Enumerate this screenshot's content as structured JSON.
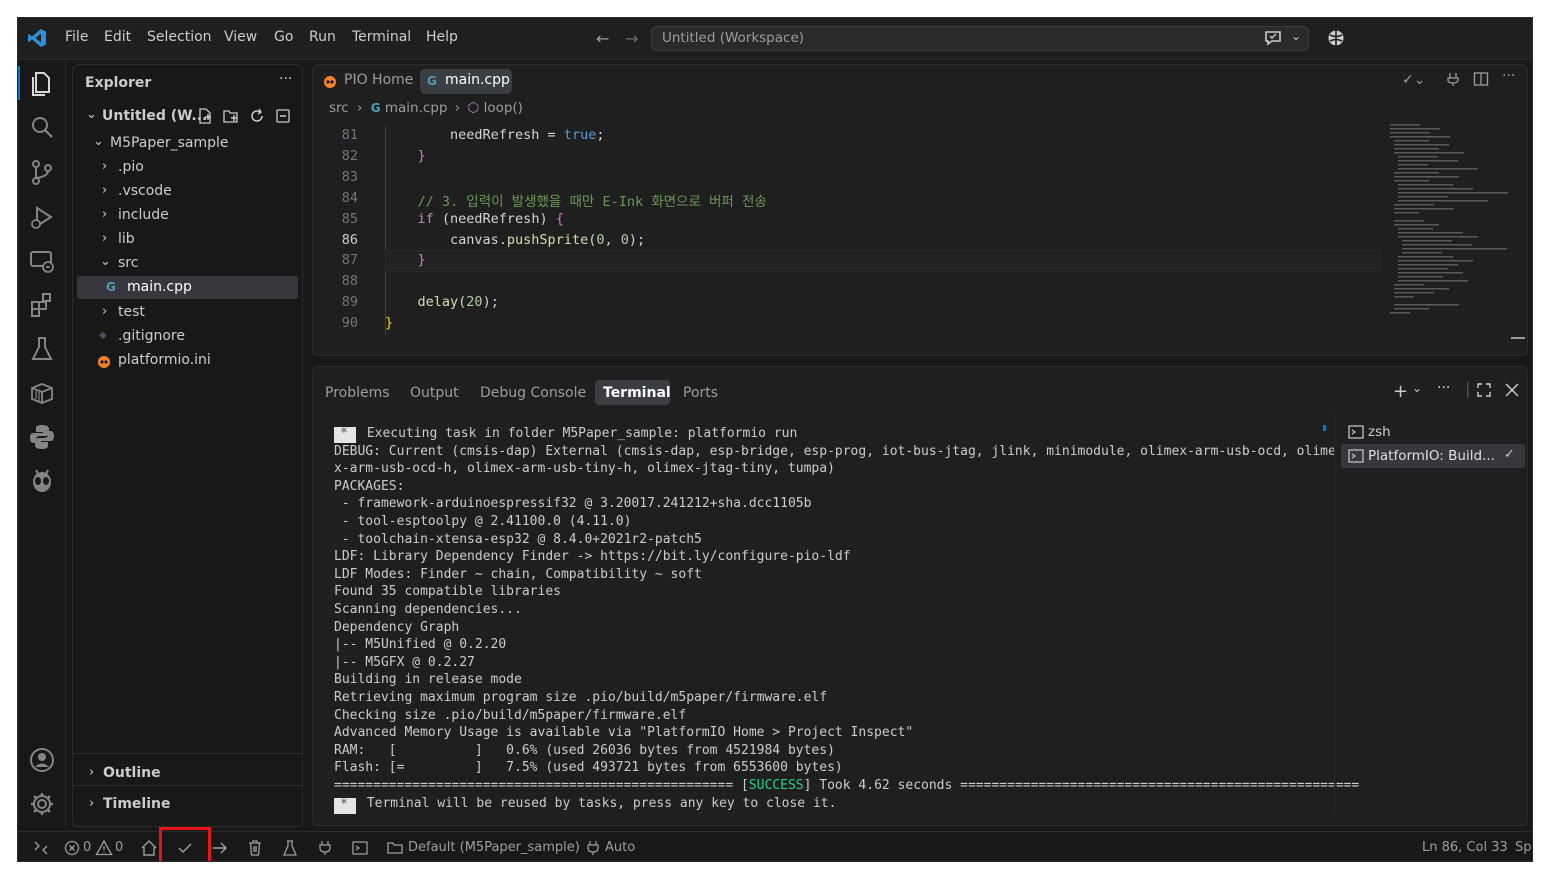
{
  "titlebar": {
    "menu": [
      "File",
      "Edit",
      "Selection",
      "View",
      "Go",
      "Run",
      "Terminal",
      "Help"
    ],
    "command_center": "Untitled (Workspace)"
  },
  "explorer": {
    "title": "Explorer",
    "workspace": "Untitled (W...",
    "folder": "M5Paper_sample",
    "items": [
      {
        "label": ".pio",
        "type": "folder"
      },
      {
        "label": ".vscode",
        "type": "folder"
      },
      {
        "label": "include",
        "type": "folder"
      },
      {
        "label": "lib",
        "type": "folder"
      },
      {
        "label": "src",
        "type": "folder-open"
      },
      {
        "label": "main.cpp",
        "type": "file-cpp",
        "selected": true
      },
      {
        "label": "test",
        "type": "folder"
      },
      {
        "label": ".gitignore",
        "type": "file-git"
      },
      {
        "label": "platformio.ini",
        "type": "file-pio"
      }
    ],
    "outline": "Outline",
    "timeline": "Timeline"
  },
  "editor": {
    "tabs": [
      {
        "label": "PIO Home",
        "active": false
      },
      {
        "label": "main.cpp",
        "active": true
      }
    ],
    "breadcrumb": [
      "src",
      "main.cpp",
      "loop()"
    ],
    "lines": [
      {
        "n": "81",
        "tokens": [
          {
            "t": "        needRefresh = ",
            "c": "#d4d4d4"
          },
          {
            "t": "true",
            "c": "#569cd6"
          },
          {
            "t": ";",
            "c": "#d4d4d4"
          }
        ]
      },
      {
        "n": "82",
        "tokens": [
          {
            "t": "    }",
            "c": "#da70d6"
          }
        ]
      },
      {
        "n": "83",
        "tokens": []
      },
      {
        "n": "84",
        "tokens": [
          {
            "t": "    // 3. 입력이 발생했을 때만 E-Ink 화면으로 버퍼 전송",
            "c": "#6a9955"
          }
        ]
      },
      {
        "n": "85",
        "tokens": [
          {
            "t": "    if",
            "c": "#c586c0"
          },
          {
            "t": " (needRefresh) ",
            "c": "#d4d4d4"
          },
          {
            "t": "{",
            "c": "#da70d6"
          }
        ]
      },
      {
        "n": "86",
        "tokens": [
          {
            "t": "        canvas.",
            "c": "#d4d4d4"
          },
          {
            "t": "pushSprite",
            "c": "#dcdcaa"
          },
          {
            "t": "(",
            "c": "#d4d4d4"
          },
          {
            "t": "0",
            "c": "#b5cea8"
          },
          {
            "t": ", ",
            "c": "#d4d4d4"
          },
          {
            "t": "0",
            "c": "#b5cea8"
          },
          {
            "t": ");",
            "c": "#d4d4d4"
          }
        ]
      },
      {
        "n": "87",
        "tokens": [
          {
            "t": "    }",
            "c": "#da70d6"
          }
        ]
      },
      {
        "n": "88",
        "tokens": []
      },
      {
        "n": "89",
        "tokens": [
          {
            "t": "    ",
            "c": "#d4d4d4"
          },
          {
            "t": "delay",
            "c": "#dcdcaa"
          },
          {
            "t": "(",
            "c": "#d4d4d4"
          },
          {
            "t": "20",
            "c": "#b5cea8"
          },
          {
            "t": ");",
            "c": "#d4d4d4"
          }
        ]
      },
      {
        "n": "90",
        "tokens": [
          {
            "t": "}",
            "c": "#ffd700"
          }
        ]
      }
    ]
  },
  "panel": {
    "tabs": [
      "Problems",
      "Output",
      "Debug Console",
      "Terminal",
      "Ports"
    ],
    "active_tab": "Terminal",
    "terminal_lines": [
      " Executing task in folder M5Paper_sample: platformio run",
      "DEBUG: Current (cmsis-dap) External (cmsis-dap, esp-bridge, esp-prog, iot-bus-jtag, jlink, minimodule, olimex-arm-usb-ocd, olime",
      "x-arm-usb-ocd-h, olimex-arm-usb-tiny-h, olimex-jtag-tiny, tumpa)",
      "PACKAGES:",
      " - framework-arduinoespressif32 @ 3.20017.241212+sha.dcc1105b",
      " - tool-esptoolpy @ 2.41100.0 (4.11.0)",
      " - toolchain-xtensa-esp32 @ 8.4.0+2021r2-patch5",
      "LDF: Library Dependency Finder -> https://bit.ly/configure-pio-ldf",
      "LDF Modes: Finder ~ chain, Compatibility ~ soft",
      "Found 35 compatible libraries",
      "Scanning dependencies...",
      "Dependency Graph",
      "|-- M5Unified @ 0.2.20",
      "|-- M5GFX @ 0.2.27",
      "Building in release mode",
      "Retrieving maximum program size .pio/build/m5paper/firmware.elf",
      "Checking size .pio/build/m5paper/firmware.elf",
      "Advanced Memory Usage is available via \"PlatformIO Home > Project Inspect\"",
      "RAM:   [          ]   0.6% (used 26036 bytes from 4521984 bytes)",
      "Flash: [=         ]   7.5% (used 493721 bytes from 6553600 bytes)"
    ],
    "success_left": "=================================================== [",
    "success_word": "SUCCESS",
    "success_right": "] Took 4.62 seconds ===================================================",
    "last_line": " Terminal will be reused by tasks, press any key to close it.",
    "terminals": [
      "zsh",
      "PlatformIO: Build..."
    ]
  },
  "statusbar": {
    "errors": "0",
    "warnings": "0",
    "env": "Default (M5Paper_sample)",
    "port": "Auto",
    "position": "Ln 86, Col 33",
    "truncated": "Sp"
  },
  "colors": {
    "accent": "#0078d4",
    "highlight_box": "#e8141c",
    "success": "#23d18b"
  }
}
